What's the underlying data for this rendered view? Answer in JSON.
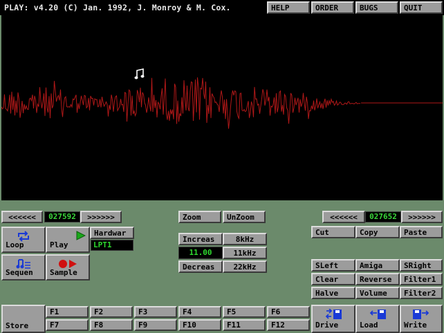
{
  "title": "PLAY: v4.20 (C) Jan. 1992, J. Monroy & M. Cox.",
  "menu": [
    "HELP",
    "ORDER",
    "BUGS",
    "QUIT"
  ],
  "note_icon": "music-note-icon",
  "colors": {
    "background": "#6b8a6b",
    "waveform": "#b01818",
    "counter": "#3ad63a",
    "button": "#9c9c9c"
  },
  "left_nav": {
    "back": "<<<<<<",
    "position": "027592",
    "forward": ">>>>>>"
  },
  "right_nav": {
    "back": "<<<<<<",
    "position": "027652",
    "forward": ">>>>>>"
  },
  "zoom": {
    "zoom": "Zoom",
    "unzoom": "UnZoom"
  },
  "play_controls": {
    "loop": "Loop",
    "play": "Play",
    "sequence": "Sequen",
    "sample": "Sample"
  },
  "hardware": {
    "label": "Hardwar",
    "port": "LPT1"
  },
  "rate": {
    "increase": "Increas",
    "value": "11.00",
    "decrease": "Decreas",
    "r8": "8kHz",
    "r11": "11kHz",
    "r22": "22kHz"
  },
  "edit": {
    "cut": "Cut",
    "copy": "Copy",
    "paste": "Paste"
  },
  "effects": [
    [
      "SLeft",
      "Amiga",
      "SRight"
    ],
    [
      "Clear",
      "Reverse",
      "Filter1"
    ],
    [
      "Halve",
      "Volume",
      "Filter2"
    ]
  ],
  "store": "Store",
  "fkeys_top": [
    "F1",
    "F2",
    "F3",
    "F4",
    "F5",
    "F6"
  ],
  "fkeys_bottom": [
    "F7",
    "F8",
    "F9",
    "F10",
    "F11",
    "F12"
  ],
  "file": {
    "drive": "Drive",
    "load": "Load",
    "write": "Write"
  }
}
